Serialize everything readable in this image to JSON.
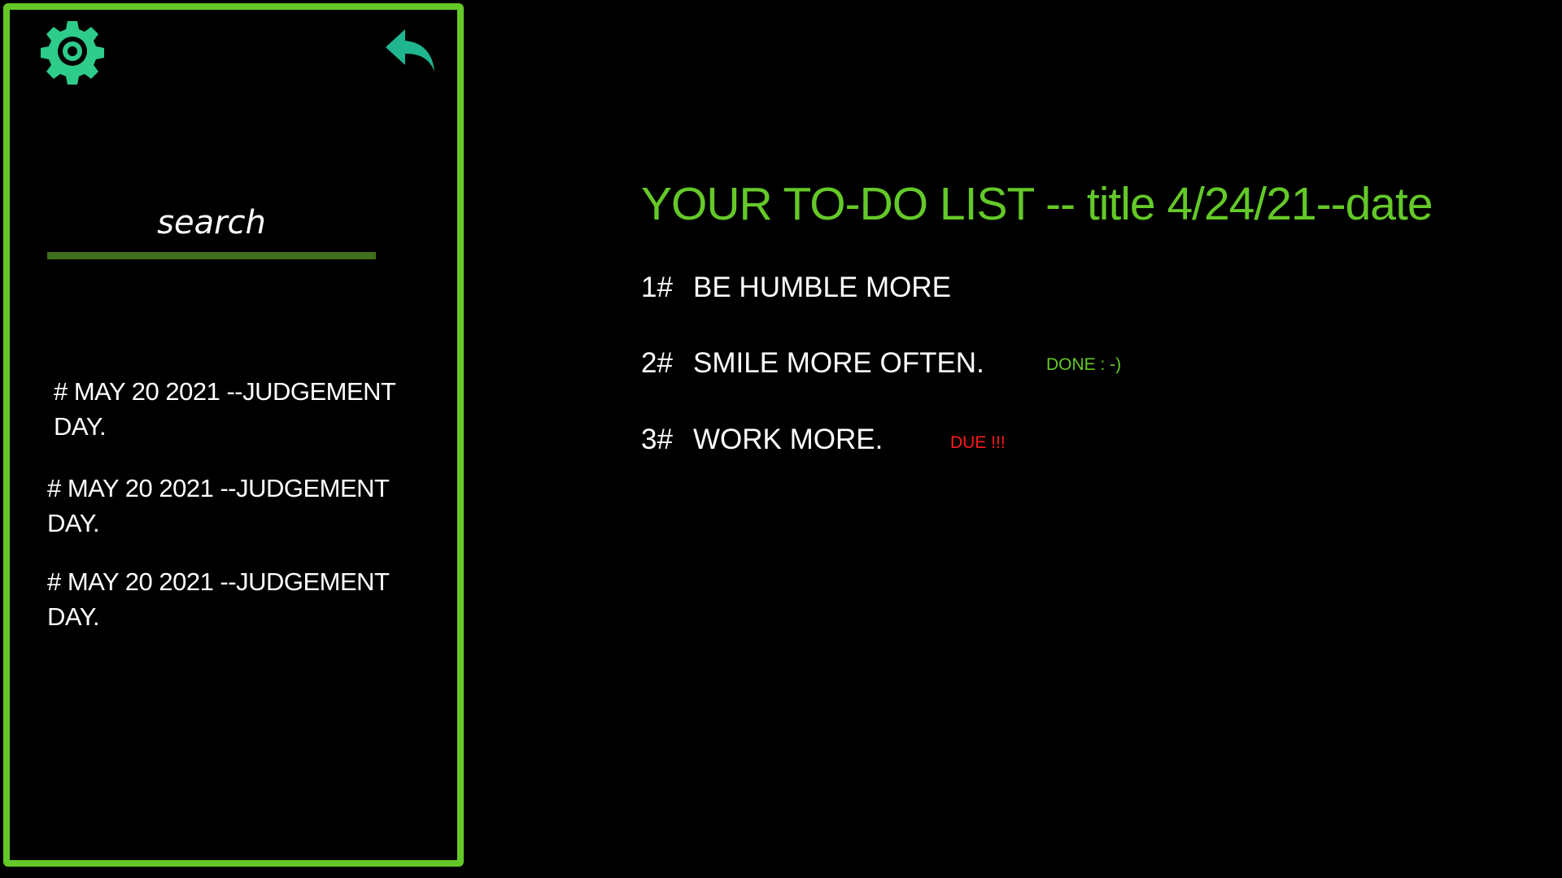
{
  "colors": {
    "accent": "#64c928",
    "icon": "#2ecc8a",
    "due": "#ff1a1a",
    "text": "#ffffff",
    "background": "#000000"
  },
  "sidebar": {
    "settings_icon": "gear-icon",
    "back_icon": "reply-arrow-icon",
    "search": {
      "placeholder": "search",
      "value": ""
    },
    "notes": [
      {
        "label": "# MAY 20 2021 --JUDGEMENT DAY."
      },
      {
        "label": "# MAY 20 2021 --JUDGEMENT DAY."
      },
      {
        "label": "# MAY 20 2021 --JUDGEMENT DAY."
      }
    ]
  },
  "main": {
    "title": "YOUR TO-DO LIST -- title  4/24/21--date",
    "todos": [
      {
        "number": "1#",
        "text": "BE HUMBLE MORE",
        "status": ""
      },
      {
        "number": "2#",
        "text": "SMILE MORE OFTEN.",
        "status": "DONE : -)"
      },
      {
        "number": "3#",
        "text": "WORK MORE.",
        "status": "DUE !!!"
      }
    ]
  }
}
